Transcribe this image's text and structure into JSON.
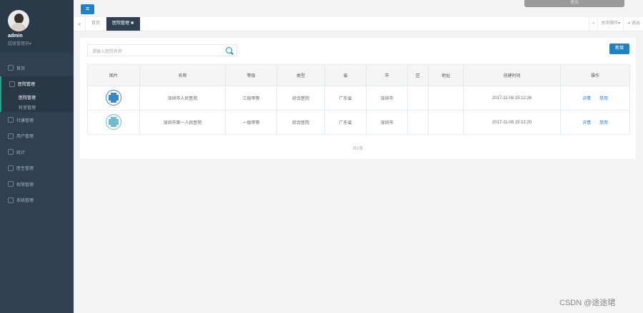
{
  "sidebar": {
    "user": "admin",
    "role": "超级管理员",
    "role_caret": "▾",
    "items": [
      {
        "label": "首页"
      },
      {
        "label": "医院管理"
      },
      {
        "label": "社康管理"
      },
      {
        "label": "用户管理"
      },
      {
        "label": "统计"
      },
      {
        "label": "医生管理"
      },
      {
        "label": "权限管理"
      },
      {
        "label": "系统管理"
      }
    ],
    "sub_items": [
      {
        "label": "医院管理"
      },
      {
        "label": "科室管理"
      }
    ]
  },
  "topbar": {
    "menu_icon": "≡",
    "ghost_button": "退出"
  },
  "tabs": {
    "left_arrow": "«",
    "right_arrow": "»",
    "items": [
      {
        "label": "首页"
      },
      {
        "label": "医院管理 ✖"
      }
    ],
    "close_ops": "关闭操作▾",
    "logout": "⇥ 退出"
  },
  "main": {
    "search_placeholder": "请输入医院名称",
    "add_label": "新增",
    "columns": [
      "图片",
      "名称",
      "等级",
      "类型",
      "省",
      "市",
      "区",
      "地址",
      "创建时间",
      "操作"
    ],
    "rows": [
      {
        "name": "深圳市人民医院",
        "level": "三级甲等",
        "type": "综合医院",
        "province": "广东省",
        "city": "深圳市",
        "district": "",
        "address": "",
        "created": "2017-11-08 15:12:26",
        "op1": "详情",
        "op2": "禁用"
      },
      {
        "name": "深圳市第一人民医院",
        "level": "一级甲等",
        "type": "综合医院",
        "province": "广东省",
        "city": "深圳市",
        "district": "",
        "address": "",
        "created": "2017-11-08 15:12:20",
        "op1": "详情",
        "op2": "禁用"
      }
    ],
    "pager": "共2条"
  },
  "watermark": "CSDN @途途珺",
  "colors": {
    "sidebar": "#2f4050",
    "accent": "#1c84c6",
    "active_border": "#19aa8d"
  }
}
